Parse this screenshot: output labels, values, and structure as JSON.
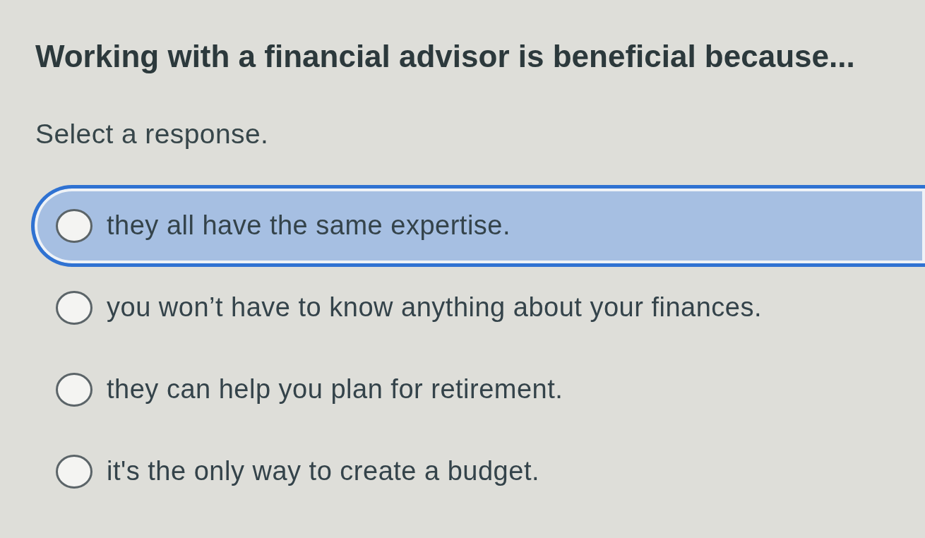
{
  "question": {
    "title": "Working with a financial advisor is beneficial because...",
    "instruction": "Select a response.",
    "options": [
      {
        "text": "they all have the same expertise.",
        "selected": false,
        "highlighted": true
      },
      {
        "text": "you won’t have to know anything about your finances.",
        "selected": false,
        "highlighted": false
      },
      {
        "text": "they can help you plan for retirement.",
        "selected": false,
        "highlighted": false
      },
      {
        "text": "it's the only way to create a budget.",
        "selected": false,
        "highlighted": false
      }
    ]
  }
}
